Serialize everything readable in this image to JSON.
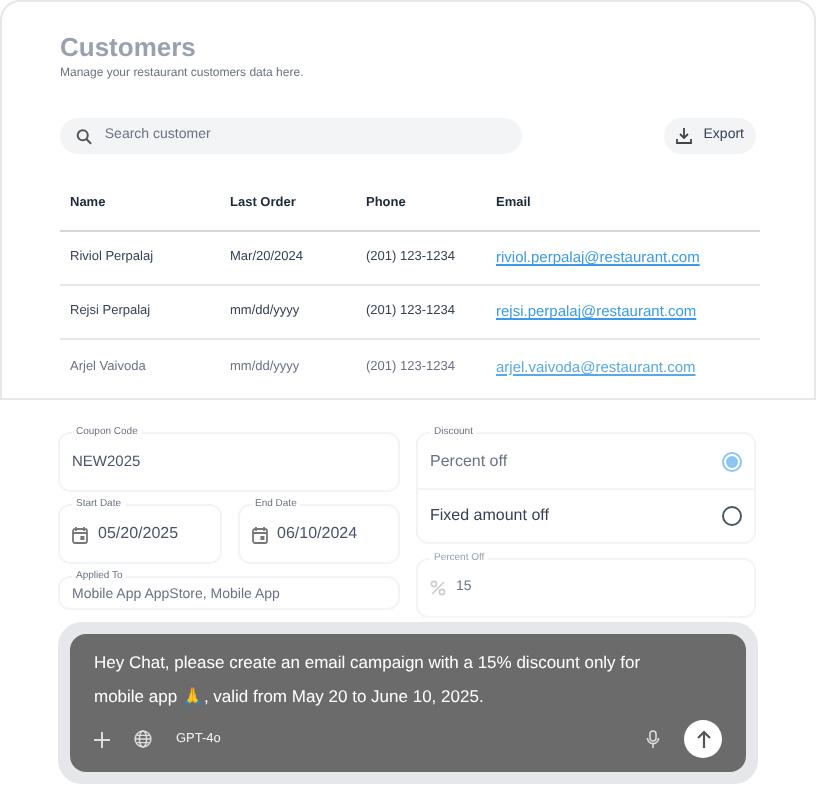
{
  "header": {
    "title": "Customers",
    "subtitle": "Manage your restaurant customers data here."
  },
  "search": {
    "placeholder": "Search customer"
  },
  "export_button": {
    "label": "Export"
  },
  "table": {
    "columns": [
      "Name",
      "Last Order",
      "Phone",
      "Email"
    ],
    "rows": [
      {
        "faded": false,
        "cells": [
          "Riviol Perpalaj",
          "Mar/20/2024",
          "(201) 123-1234",
          "riviol.perpalaj@restaurant.com"
        ]
      },
      {
        "faded": false,
        "cells": [
          "Rejsi Perpalaj",
          "mm/dd/yyyy",
          "(201) 123-1234",
          "rejsi.perpalaj@restaurant.com"
        ]
      },
      {
        "faded": true,
        "cells": [
          "Arjel Vaivoda",
          "mm/dd/yyyy",
          "(201) 123-1234",
          "arjel.vaivoda@restaurant.com"
        ]
      }
    ]
  },
  "form": {
    "coupon_code": {
      "label": "Coupon Code",
      "value": "NEW2025"
    },
    "start_date": {
      "label": "Start Date",
      "value": "05/20/2025"
    },
    "end_date": {
      "label": "End Date",
      "value": "06/10/2024"
    },
    "applied_to": {
      "label": "Applied To",
      "value": "Mobile App AppStore, Mobile App"
    },
    "discount": {
      "label": "Discount",
      "options": [
        {
          "label": "Percent off",
          "selected": true
        },
        {
          "label": "Fixed amount off",
          "selected": false
        }
      ]
    },
    "percent_off": {
      "label": "Percent Off",
      "value": "15"
    }
  },
  "chat": {
    "message": "Hey Chat, please create an email campaign with a 15% discount only for mobile app 🙏, valid from May 20 to June 10, 2025.",
    "model": "GPT-4o"
  }
}
